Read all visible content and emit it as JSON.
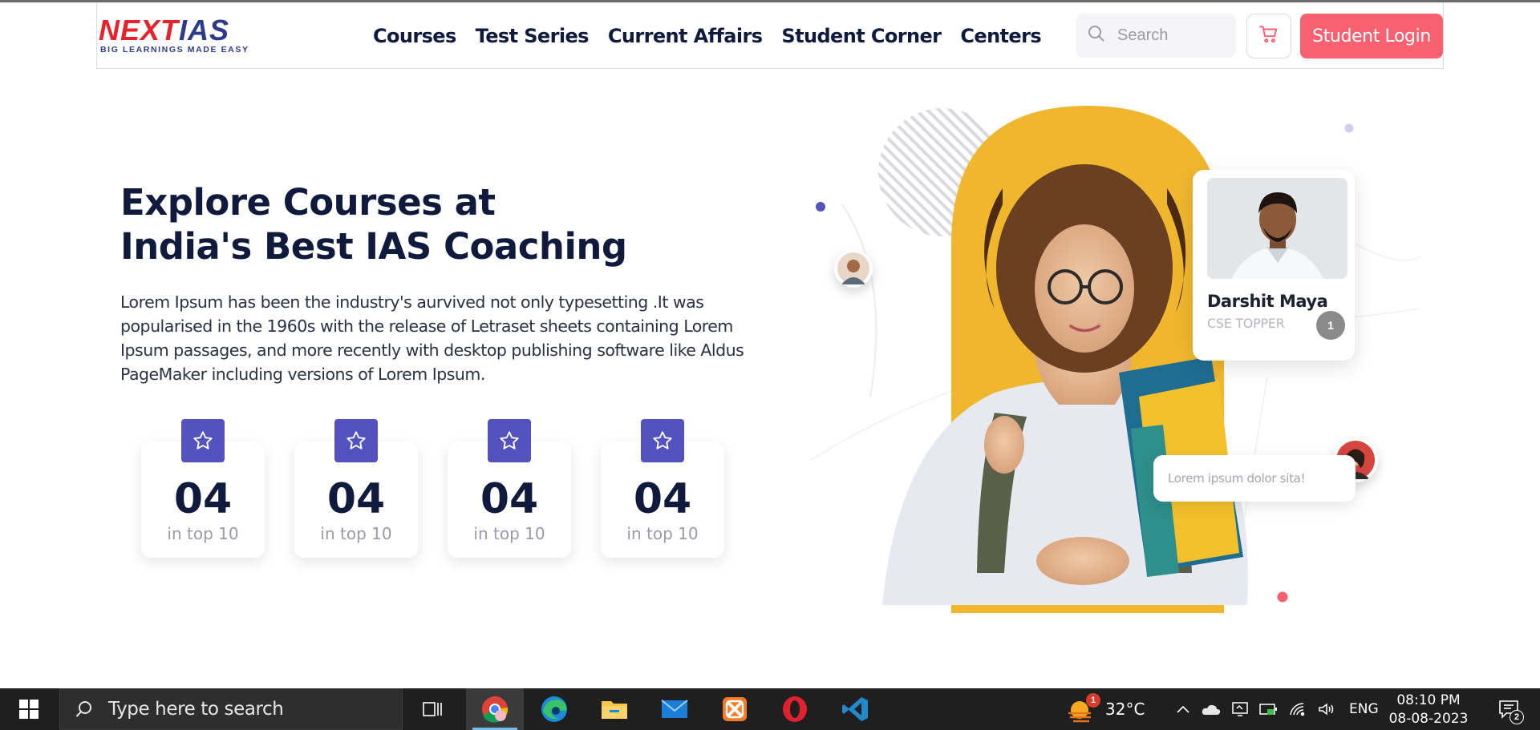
{
  "brand": {
    "logo_next": "NEXT",
    "logo_ias": "IAS",
    "tagline": "BIG LEARNINGS MADE EASY",
    "accent_red": "#e4232b",
    "accent_blue": "#2e3b8c"
  },
  "nav": {
    "items": [
      {
        "label": "Courses"
      },
      {
        "label": "Test Series"
      },
      {
        "label": "Current Affairs"
      },
      {
        "label": "Student Corner"
      },
      {
        "label": "Centers"
      }
    ]
  },
  "search": {
    "placeholder": "Search",
    "icon": "search-icon"
  },
  "cart": {
    "icon": "cart-icon"
  },
  "login": {
    "label": "Student Login",
    "color": "#f8616f"
  },
  "hero": {
    "title_line1": "Explore Courses at",
    "title_line2": "India's Best IAS Coaching",
    "description": "Lorem Ipsum has been the industry's aurvived not only typesetting .It was popularised in the 1960s with the release of Letraset sheets containing Lorem Ipsum passages, and more recently with desktop publishing software like Aldus PageMaker including versions of Lorem Ipsum."
  },
  "stats": [
    {
      "value": "04",
      "label": "in top 10",
      "icon": "star-icon"
    },
    {
      "value": "04",
      "label": "in top 10",
      "icon": "star-icon"
    },
    {
      "value": "04",
      "label": "in top 10",
      "icon": "star-icon"
    },
    {
      "value": "04",
      "label": "in top 10",
      "icon": "star-icon"
    }
  ],
  "stat_icon_color": "#5352be",
  "topper": {
    "name": "Darshit Maya",
    "role": "CSE TOPPER",
    "rank": "1"
  },
  "message": {
    "text": "Lorem ipsum dolor sita!"
  },
  "taskbar": {
    "search_text": "Type here to search",
    "weather_badge": "1",
    "temperature": "32°C",
    "language": "ENG",
    "time": "08:10 PM",
    "date": "08-08-2023",
    "notification_count": "2",
    "apps": [
      "task-view",
      "chrome",
      "edge",
      "file-explorer",
      "mail",
      "xampp",
      "opera",
      "vscode"
    ]
  }
}
